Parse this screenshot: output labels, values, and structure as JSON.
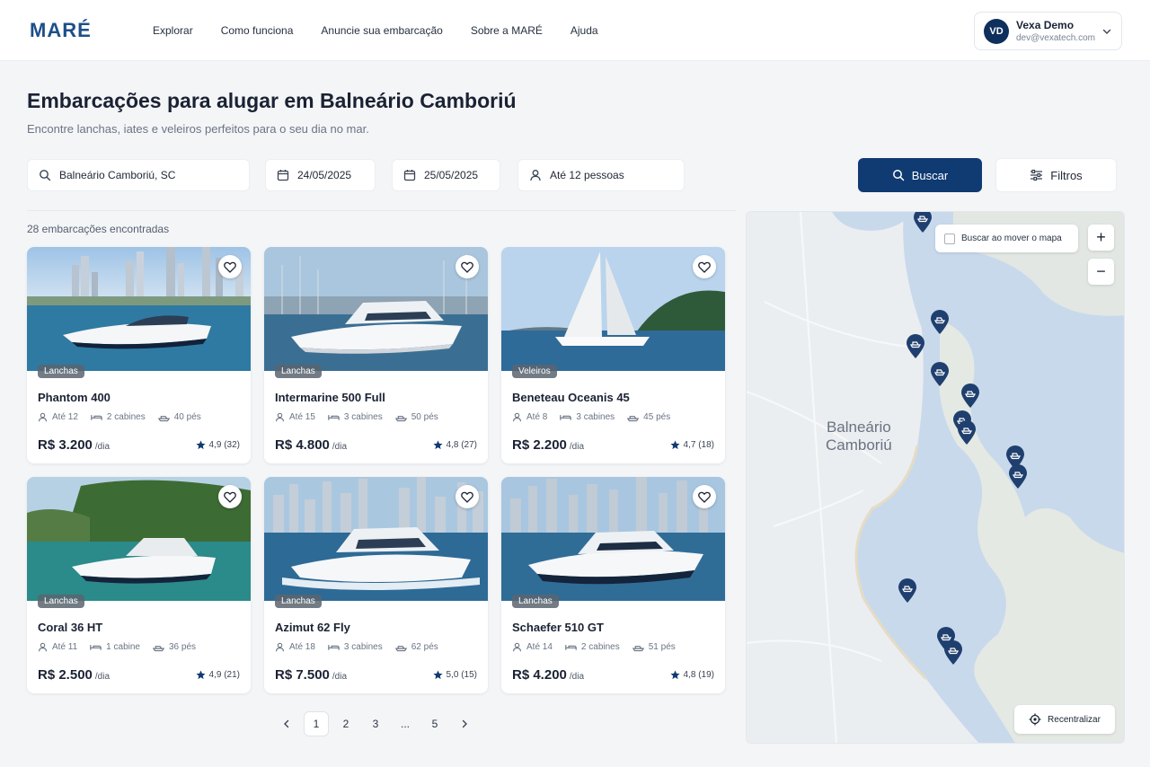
{
  "header": {
    "logo": "MARÉ",
    "nav": [
      "Explorar",
      "Como funciona",
      "Anuncie sua embarcação",
      "Sobre a MARÉ",
      "Ajuda"
    ],
    "user": {
      "initials": "VD",
      "name": "Vexa Demo",
      "email": "dev@vexatech.com"
    }
  },
  "page": {
    "title": "Embarcações para alugar em Balneário Camboriú",
    "subtitle": "Encontre lanchas, iates e veleiros perfeitos para o seu dia no mar."
  },
  "search": {
    "location": "Balneário Camboriú, SC",
    "date_start": "24/05/2025",
    "date_end": "25/05/2025",
    "guests": "Até 12 pessoas",
    "search_label": "Buscar",
    "filters_label": "Filtros"
  },
  "results": {
    "count_text": "28 embarcações encontradas",
    "boats": [
      {
        "category": "Lanchas",
        "name": "Phantom 400",
        "people": "Até 12",
        "cabins": "2 cabines",
        "length": "40 pés",
        "price": "R$ 3.200",
        "unit": "/dia",
        "rating": "4,9 (32)"
      },
      {
        "category": "Lanchas",
        "name": "Intermarine 500 Full",
        "people": "Até 15",
        "cabins": "3 cabines",
        "length": "50 pés",
        "price": "R$ 4.800",
        "unit": "/dia",
        "rating": "4,8 (27)"
      },
      {
        "category": "Veleiros",
        "name": "Beneteau Oceanis 45",
        "people": "Até 8",
        "cabins": "3 cabines",
        "length": "45 pés",
        "price": "R$ 2.200",
        "unit": "/dia",
        "rating": "4,7 (18)"
      },
      {
        "category": "Lanchas",
        "name": "Coral 36 HT",
        "people": "Até 11",
        "cabins": "1 cabine",
        "length": "36 pés",
        "price": "R$ 2.500",
        "unit": "/dia",
        "rating": "4,9 (21)"
      },
      {
        "category": "Lanchas",
        "name": "Azimut 62 Fly",
        "people": "Até 18",
        "cabins": "3 cabines",
        "length": "62 pés",
        "price": "R$ 7.500",
        "unit": "/dia",
        "rating": "5,0 (15)"
      },
      {
        "category": "Lanchas",
        "name": "Schaefer 510 GT",
        "people": "Até 14",
        "cabins": "2 cabines",
        "length": "51 pés",
        "price": "R$ 4.200",
        "unit": "/dia",
        "rating": "4,8 (19)"
      }
    ]
  },
  "pagination": {
    "pages": [
      "1",
      "2",
      "3",
      "...",
      "5"
    ],
    "current": "1"
  },
  "map": {
    "checkbox_label": "Buscar ao mover o mapa",
    "city_line1": "Balneário",
    "city_line2": "Camboriú",
    "recenter_label": "Recentralizar",
    "zoom_in": "+",
    "zoom_out": "−"
  },
  "colors": {
    "primary": "#0f3a72",
    "star": "#0f3a72",
    "pin": "#1f3f6e",
    "water": "#c9d9ec",
    "land": "#ebeef1"
  }
}
